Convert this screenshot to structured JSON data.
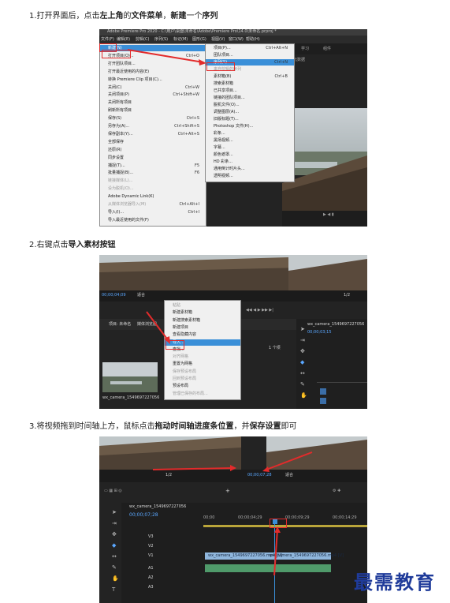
{
  "steps": [
    {
      "prefix": "1.打开界面后，点击",
      "b1": "左上角",
      "mid1": "的",
      "b2": "文件菜单",
      "mid2": "，",
      "b3": "新建",
      "mid3": "一个",
      "b4": "序列"
    },
    {
      "prefix": "2.右键点击",
      "b1": "导入素材按钮"
    },
    {
      "prefix": "3.将视频拖到时间轴上方，鼠标点击",
      "b1": "拖动时间轴进度条位置",
      "mid1": "，并",
      "b2": "保存设置",
      "mid2": "即可"
    }
  ],
  "shot1": {
    "titlebar": "Adobe Premiere Pro 2020 - C:\\用户\\桌面\\未命名\\Adobe\\Premiere Pro\\14.0\\未命名.prproj *",
    "menubar": [
      "文件(F)",
      "编辑(E)",
      "剪辑(C)",
      "序列(S)",
      "标记(M)",
      "图形(G)",
      "视图(V)",
      "窗口(W)",
      "帮助(H)"
    ],
    "right_tabs": [
      "学习",
      "组件",
      "元数据"
    ],
    "file_menu": [
      {
        "label": "新建(N)",
        "sc": "",
        "state": "hl"
      },
      {
        "label": "打开项目(O)...",
        "sc": "Ctrl+O"
      },
      {
        "label": "打开团队项目...",
        "sc": ""
      },
      {
        "label": "打开最近使用的内容(E)",
        "sc": ""
      },
      {
        "label": "转换 Premiere Clip 项目(C)...",
        "sc": ""
      },
      {
        "label": "关闭(C)",
        "sc": "Ctrl+W"
      },
      {
        "label": "关闭项目(P)",
        "sc": "Ctrl+Shift+W"
      },
      {
        "label": "关闭所有项目",
        "sc": ""
      },
      {
        "label": "刷新所有项目",
        "sc": ""
      },
      {
        "label": "保存(S)",
        "sc": "Ctrl+S"
      },
      {
        "label": "另存为(A)...",
        "sc": "Ctrl+Shift+S"
      },
      {
        "label": "保存副本(Y)...",
        "sc": "Ctrl+Alt+S"
      },
      {
        "label": "全部保存",
        "sc": ""
      },
      {
        "label": "还原(R)",
        "sc": ""
      },
      {
        "label": "同步设置",
        "sc": ""
      },
      {
        "label": "捕捉(T)...",
        "sc": "F5"
      },
      {
        "label": "批量捕捉(B)...",
        "sc": "F6"
      },
      {
        "label": "链接媒体(L)...",
        "sc": "",
        "state": "dis"
      },
      {
        "label": "设为脱机(O)...",
        "sc": "",
        "state": "dis"
      },
      {
        "label": "Adobe Dynamic Link(K)",
        "sc": ""
      },
      {
        "label": "从媒体浏览器导入(M)",
        "sc": "Ctrl+Alt+I",
        "state": "dis"
      },
      {
        "label": "导入(I)...",
        "sc": "Ctrl+I"
      },
      {
        "label": "导入最近使用的文件(F)",
        "sc": ""
      }
    ],
    "new_submenu": [
      {
        "label": "项目(P)...",
        "sc": "Ctrl+Alt+N"
      },
      {
        "label": "团队项目...",
        "sc": ""
      },
      {
        "label": "序列(S)...",
        "sc": "Ctrl+N",
        "state": "hl"
      },
      {
        "label": "来自剪辑的序列",
        "sc": "",
        "state": "dis"
      },
      {
        "label": "素材箱(B)",
        "sc": "Ctrl+B"
      },
      {
        "label": "搜索素材箱",
        "sc": ""
      },
      {
        "label": "已共享项目...",
        "sc": ""
      },
      {
        "label": "链接的团队项目...",
        "sc": ""
      },
      {
        "label": "脱机文件(O)...",
        "sc": ""
      },
      {
        "label": "调整图层(A)...",
        "sc": ""
      },
      {
        "label": "旧版标题(T)...",
        "sc": ""
      },
      {
        "label": "Photoshop 文件(H)...",
        "sc": ""
      },
      {
        "label": "彩条...",
        "sc": ""
      },
      {
        "label": "黑场视频...",
        "sc": ""
      },
      {
        "label": "字幕...",
        "sc": ""
      },
      {
        "label": "颜色遮罩...",
        "sc": ""
      },
      {
        "label": "HD 彩条...",
        "sc": ""
      },
      {
        "label": "通用倒计时片头...",
        "sc": ""
      },
      {
        "label": "透明视频...",
        "sc": ""
      }
    ]
  },
  "shot2": {
    "timecode": "00;00;04;09",
    "fit": "适合",
    "fraction": "1/2",
    "context_menu": [
      {
        "label": "粘贴",
        "state": "dis"
      },
      {
        "label": "新建素材箱",
        "state": ""
      },
      {
        "label": "新建搜索素材箱",
        "state": ""
      },
      {
        "label": "新建项目",
        "state": ""
      },
      {
        "label": "查看隐藏内容",
        "state": ""
      },
      {
        "label": "导入...",
        "state": "hl"
      },
      {
        "label": "查找...",
        "state": ""
      },
      {
        "label": "对齐网格",
        "state": "dis"
      },
      {
        "label": "重置为网格",
        "state": ""
      },
      {
        "label": "保存预设布局",
        "state": "dis"
      },
      {
        "label": "回到预设布局",
        "state": "dis"
      },
      {
        "label": "预设布局",
        "state": ""
      },
      {
        "label": "管理已保存的布局...",
        "state": "dis"
      }
    ],
    "project_tab": "项目: 未命名",
    "media_browser": "媒体浏览器",
    "clip_name": "wx_camera_1549697227056",
    "seq_tab": "wx_camera_1549697227056",
    "seq_timecode": "00;00;03;15",
    "items_count": "1 个项"
  },
  "shot3": {
    "fraction": "1/2",
    "fit": "适合",
    "timecode_monitor": "00;00;07;28",
    "seq_tab": "wx_camera_1549697227056",
    "seq_timecode": "00;00;07;28",
    "ruler": [
      "00;00",
      "00;00;04;29",
      "00;00;09;29",
      "00;00;14;29"
    ],
    "tracks": [
      "V3",
      "V2",
      "V1",
      "A1",
      "A2",
      "A3"
    ],
    "clip_video": "wx_camera_1549697227056.mp4 [V]",
    "clip_video2": "wx_camera_1549697227056.mp4 [V]"
  },
  "watermark": "最需教育",
  "colors": {
    "red": "#e32b2b",
    "blue_tc": "#5aa7ff",
    "menu_hl": "#3a8fd8",
    "watermark": "#1f3b9a"
  }
}
